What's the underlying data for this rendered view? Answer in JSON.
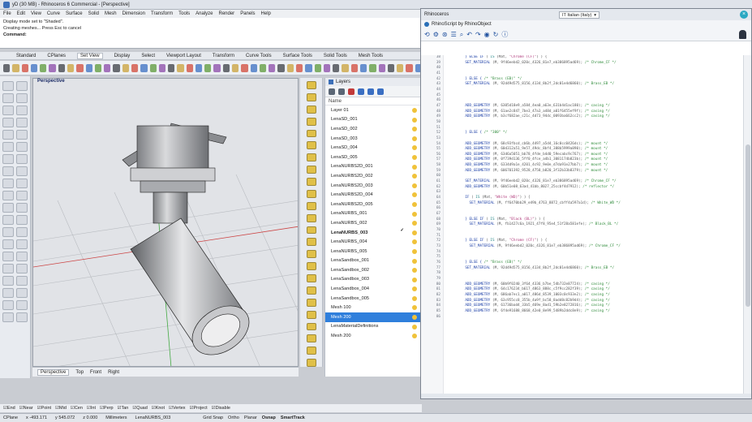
{
  "window": {
    "title": "yD (30 MB) - Rhinoceros 6 Commercial - [Perspective]"
  },
  "menu": [
    "File",
    "Edit",
    "View",
    "Curve",
    "Surface",
    "Solid",
    "Mesh",
    "Dimension",
    "Transform",
    "Tools",
    "Analyze",
    "Render",
    "Panels",
    "Help"
  ],
  "command": {
    "line1": "Display mode set to \"Shaded\".",
    "line2": "Creating meshes... Press Esc to cancel",
    "label": "Command:"
  },
  "toolbar_tabs": [
    "Standard",
    "CPlanes",
    "Set View",
    "Display",
    "Select",
    "Viewport Layout",
    "Transform",
    "Curve Tools",
    "Surface Tools",
    "Solid Tools",
    "Mesh Tools"
  ],
  "viewport": {
    "label": "Perspective"
  },
  "viewport_tabs": [
    "Perspective",
    "Top",
    "Front",
    "Right"
  ],
  "layers": {
    "title": "Layers",
    "column": "Name",
    "items": [
      "Layer 01",
      "LenaSD_001",
      "LenaSD_002",
      "LenaSD_003",
      "LenaSD_004",
      "LenaSD_005",
      "LenaNURBS2D_001",
      "LenaNURBS2D_002",
      "LenaNURBS2D_003",
      "LenaNURBS2D_004",
      "LenaNURBS2D_005",
      "LenaNURBS_001",
      "LenaNURBS_002",
      "LenaNURBS_003",
      "LenaNURBS_004",
      "LenaNURBS_005",
      "LenaSandbox_001",
      "LenaSandbox_002",
      "LenaSandbox_003",
      "LenaSandbox_004",
      "LenaSandbox_005",
      "Mesh 100",
      "Mesh 200",
      "LenaMaterialDefinitions",
      "Mesh 200"
    ],
    "current": "LenaNURBS_003",
    "selected": "Mesh 200"
  },
  "osnap": [
    "End",
    "Near",
    "Point",
    "Mid",
    "Cen",
    "Int",
    "Perp",
    "Tan",
    "Quad",
    "Knot",
    "Vertex",
    "Project",
    "Disable"
  ],
  "status": {
    "cplane": "CPlane",
    "x": "x -493.171",
    "y": "y 545.072",
    "z": "z 0.000",
    "units": "Millimeters",
    "layer": "LenaNURBS_003",
    "items": [
      "Grid Snap",
      "Ortho",
      "Planar",
      "Osnap",
      "SmartTrack"
    ]
  },
  "editor": {
    "title": "Rhinoceros",
    "language": "IT Italian (Italy)",
    "subtitle": "RhinoScript by RhinoObject",
    "lines": [
      {
        "n": "38",
        "t": [
          [
            "k",
            "    } ELSE IF "
          ],
          [
            "p",
            "( "
          ],
          [
            "n",
            "IS "
          ],
          [
            "p",
            "(Mat, "
          ],
          [
            "s",
            "\"Chrome (CF)\""
          ],
          [
            "p",
            ") ) {"
          ]
        ]
      },
      {
        "n": "39",
        "t": [
          [
            "k",
            "    SET_MATERIAL "
          ],
          [
            "p",
            "(M, 9f46eebd2_020c_4326_81e7_eb386895ad69); "
          ],
          [
            "c",
            "/* Chrome_CF */"
          ]
        ]
      },
      {
        "n": "40",
        "t": []
      },
      {
        "n": "41",
        "t": []
      },
      {
        "n": "42",
        "t": [
          [
            "k",
            "    } ELSE { "
          ],
          [
            "c",
            "/* \"Brass (EB)\" */"
          ]
        ]
      },
      {
        "n": "43",
        "t": [
          [
            "k",
            "    SET_MATERIAL "
          ],
          [
            "p",
            "(M, 92d49d575_8156_4134_8b2f_2dc01e4d6860); "
          ],
          [
            "c",
            "/* Brass_EB */"
          ]
        ]
      },
      {
        "n": "44",
        "t": []
      },
      {
        "n": "45",
        "t": []
      },
      {
        "n": "46",
        "t": []
      },
      {
        "n": "47",
        "t": [
          [
            "k",
            "    ADD_GEOMETRY "
          ],
          [
            "p",
            "(M, 6305d18e9_a584_4ea0_a63e_631b4d1ac180); "
          ],
          [
            "c",
            "/* casing */"
          ]
        ]
      },
      {
        "n": "48",
        "t": [
          [
            "k",
            "    ADD_GEOMETRY "
          ],
          [
            "p",
            "(M, 61ae2c847_7be3_47a3_a48d_a01f6455ef9f); "
          ],
          [
            "c",
            "/* casing */"
          ]
        ]
      },
      {
        "n": "49",
        "t": [
          [
            "k",
            "    ADD_GEOMETRY "
          ],
          [
            "p",
            "(M, b3cf682ae_c21c_4d73_94dc_0093ba662cc2); "
          ],
          [
            "c",
            "/* casing */"
          ]
        ]
      },
      {
        "n": "50",
        "t": []
      },
      {
        "n": "51",
        "t": []
      },
      {
        "n": "52",
        "t": [
          [
            "k",
            "    } ELSE { "
          ],
          [
            "c",
            "/* \"300\" */"
          ]
        ]
      },
      {
        "n": "53",
        "t": []
      },
      {
        "n": "54",
        "t": [
          [
            "k",
            "    ADD_GEOMETRY "
          ],
          [
            "p",
            "(M, 68c93fbcd_cb6b_4497_a5d4_16c0cc0426dc); "
          ],
          [
            "c",
            "/* mount */"
          ]
        ]
      },
      {
        "n": "55",
        "t": [
          [
            "k",
            "    ADD_GEOMETRY "
          ],
          [
            "p",
            "(M, 60d312a51_9e57_49dc_8bf4_388b5999a890); "
          ],
          [
            "c",
            "/* mount */"
          ]
        ]
      },
      {
        "n": "56",
        "t": [
          [
            "k",
            "    ADD_GEOMETRY "
          ],
          [
            "p",
            "(M, 63d6a5051_bb78_4fde_b4d0_59ecabc9c767); "
          ],
          [
            "c",
            "/* mount */"
          ]
        ]
      },
      {
        "n": "57",
        "t": [
          [
            "k",
            "    ADD_GEOMETRY "
          ],
          [
            "p",
            "(M, 0f739d136_5ff0_4fce_a4b1_3081174b823b); "
          ],
          [
            "c",
            "/* mount */"
          ]
        ]
      },
      {
        "n": "58",
        "t": [
          [
            "k",
            "    ADD_GEOMETRY "
          ],
          [
            "p",
            "(M, 6334d9a1e_4201_4c92_9e0e_d7da91e27bb7); "
          ],
          [
            "c",
            "/* mount */"
          ]
        ]
      },
      {
        "n": "59",
        "t": [
          [
            "k",
            "    ADD_GEOMETRY "
          ],
          [
            "p",
            "(M, 606701392_9528_4758_b820_3f32b33b8379); "
          ],
          [
            "c",
            "/* mount */"
          ]
        ]
      },
      {
        "n": "60",
        "t": []
      },
      {
        "n": "61",
        "t": [
          [
            "k",
            "    SET_MATERIAL "
          ],
          [
            "p",
            "(M, 9f46eebd2_020c_4326_81e7_eb386895ad69); "
          ],
          [
            "c",
            "/* Chrome_CF */"
          ]
        ]
      },
      {
        "n": "62",
        "t": [
          [
            "k",
            "    ADD_GEOMETRY "
          ],
          [
            "p",
            "(M, 60b51e08_63ad_41bb_8027_25ccbf4d7912); "
          ],
          [
            "c",
            "/* reflector */"
          ]
        ]
      },
      {
        "n": "63",
        "t": []
      },
      {
        "n": "64",
        "t": [
          [
            "k",
            "    IF "
          ],
          [
            "p",
            "( "
          ],
          [
            "n",
            "IS "
          ],
          [
            "p",
            "(Mat, "
          ],
          [
            "s",
            "\"White (WD)\""
          ],
          [
            "p",
            ") ) {"
          ]
        ]
      },
      {
        "n": "65",
        "t": [
          [
            "k",
            "      SET_MATERIAL "
          ],
          [
            "p",
            "(M, ff6470bb29_e49b_4763_8872_cbff4a597a1d); "
          ],
          [
            "c",
            "/* White_WD */"
          ]
        ]
      },
      {
        "n": "66",
        "t": []
      },
      {
        "n": "67",
        "t": []
      },
      {
        "n": "68",
        "t": [
          [
            "k",
            "    } ELSE IF "
          ],
          [
            "p",
            "( "
          ],
          [
            "n",
            "IS "
          ],
          [
            "p",
            "(Mat, "
          ],
          [
            "s",
            "\"Black (BL)\""
          ],
          [
            "p",
            ") ) {"
          ]
        ]
      },
      {
        "n": "69",
        "t": [
          [
            "k",
            "      SET_MATERIAL "
          ],
          [
            "p",
            "(M, fb1427c6a_1921_47f8_95e4_51f28a581efe); "
          ],
          [
            "c",
            "/* Black_BL */"
          ]
        ]
      },
      {
        "n": "70",
        "t": []
      },
      {
        "n": "71",
        "t": []
      },
      {
        "n": "72",
        "t": [
          [
            "k",
            "    } ELSE IF "
          ],
          [
            "p",
            "( "
          ],
          [
            "n",
            "IS "
          ],
          [
            "p",
            "(Mat, "
          ],
          [
            "s",
            "\"Chrome (CF)\""
          ],
          [
            "p",
            ") ) {"
          ]
        ]
      },
      {
        "n": "73",
        "t": [
          [
            "k",
            "      SET_MATERIAL "
          ],
          [
            "p",
            "(M, 9f46eebd2_020c_4326_81e7_eb386895ad69); "
          ],
          [
            "c",
            "/* Chrome_CF */"
          ]
        ]
      },
      {
        "n": "74",
        "t": []
      },
      {
        "n": "75",
        "t": []
      },
      {
        "n": "76",
        "t": [
          [
            "k",
            "    } ELSE { "
          ],
          [
            "c",
            "/* \"Brass (EB)\" */"
          ]
        ]
      },
      {
        "n": "77",
        "t": [
          [
            "k",
            "    SET_MATERIAL "
          ],
          [
            "p",
            "(M, 92d49d575_8156_4134_8b2f_2dc01e4d6860); "
          ],
          [
            "c",
            "/* Brass_EB */"
          ]
        ]
      },
      {
        "n": "78",
        "t": []
      },
      {
        "n": "79",
        "t": []
      },
      {
        "n": "80",
        "t": [
          [
            "k",
            "    ADD_GEOMETRY "
          ],
          [
            "p",
            "(M, 60b9f0240_3f64_4336_b7be_54b732e87724); "
          ],
          [
            "c",
            "/* casing */"
          ]
        ]
      },
      {
        "n": "81",
        "t": [
          [
            "k",
            "    ADD_GEOMETRY "
          ],
          [
            "p",
            "(M, 64c176234_b617_4863_888c_c5f9cc282f39); "
          ],
          [
            "c",
            "/* casing */"
          ]
        ]
      },
      {
        "n": "82",
        "t": [
          [
            "k",
            "    ADD_GEOMETRY "
          ],
          [
            "p",
            "(M, 686ab7ec1_a017_486d_8539_1003c0c933e2); "
          ],
          [
            "c",
            "/* casing */"
          ]
        ]
      },
      {
        "n": "83",
        "t": [
          [
            "k",
            "    ADD_GEOMETRY "
          ],
          [
            "p",
            "(M, 63c955cc8_355b_4a9f_bc58_8add8c82b9d4); "
          ],
          [
            "c",
            "/* casing */"
          ]
        ]
      },
      {
        "n": "84",
        "t": [
          [
            "k",
            "    ADD_GEOMETRY "
          ],
          [
            "p",
            "(M, 61736bad4_33b5_469e_8ad1_59b2e8272816); "
          ],
          [
            "c",
            "/* casing */"
          ]
        ]
      },
      {
        "n": "85",
        "t": [
          [
            "k",
            "    ADD_GEOMETRY "
          ],
          [
            "p",
            "(M, 6f4e91688_8668_42e0_8e99_5489b2ddc8e9); "
          ],
          [
            "c",
            "/* casing */"
          ]
        ]
      },
      {
        "n": "86",
        "t": []
      }
    ]
  },
  "colors": {
    "accent": "#2f7fdc",
    "keyword": "#1b3ea6",
    "comment": "#2f8b3a",
    "string": "#b0397a"
  }
}
